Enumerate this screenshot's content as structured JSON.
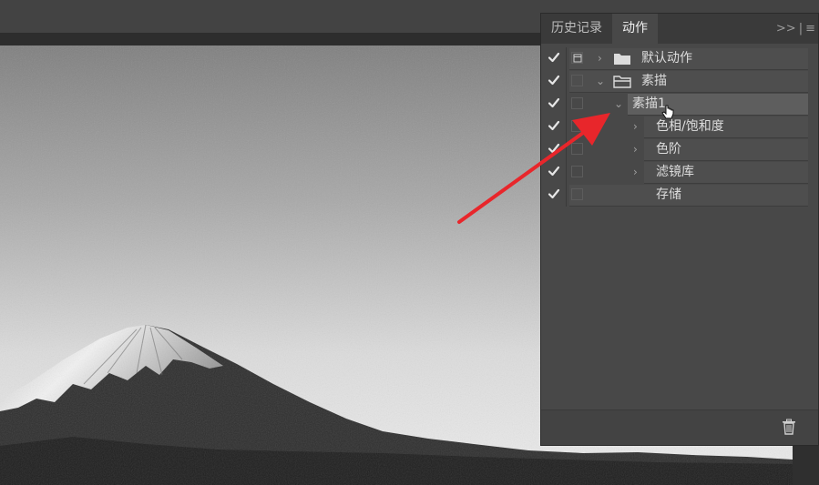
{
  "panel": {
    "tabs": [
      {
        "label": "历史记录",
        "active": false
      },
      {
        "label": "动作",
        "active": true
      }
    ],
    "menu_glyphs": [
      ">>",
      "|",
      "≡"
    ]
  },
  "actions": [
    {
      "label": "默认动作",
      "kind": "set",
      "expanded": false,
      "checked": true,
      "dialog_icon": true,
      "selected": false
    },
    {
      "label": "素描",
      "kind": "set",
      "expanded": true,
      "checked": true,
      "dialog_icon": false,
      "selected": false
    },
    {
      "label": "素描1",
      "kind": "action",
      "expanded": true,
      "checked": true,
      "dialog_icon": false,
      "selected": true
    },
    {
      "label": "色相/饱和度",
      "kind": "step",
      "expanded": false,
      "checked": true,
      "dialog_icon": false,
      "selected": false
    },
    {
      "label": "色阶",
      "kind": "step",
      "expanded": false,
      "checked": true,
      "dialog_icon": false,
      "selected": false
    },
    {
      "label": "滤镜库",
      "kind": "step",
      "expanded": false,
      "checked": true,
      "dialog_icon": false,
      "selected": false
    },
    {
      "label": "存储",
      "kind": "step",
      "expanded": null,
      "checked": true,
      "dialog_icon": false,
      "selected": false
    }
  ],
  "colors": {
    "annotation_arrow": "#e8262b",
    "panel_bg": "#484848"
  }
}
